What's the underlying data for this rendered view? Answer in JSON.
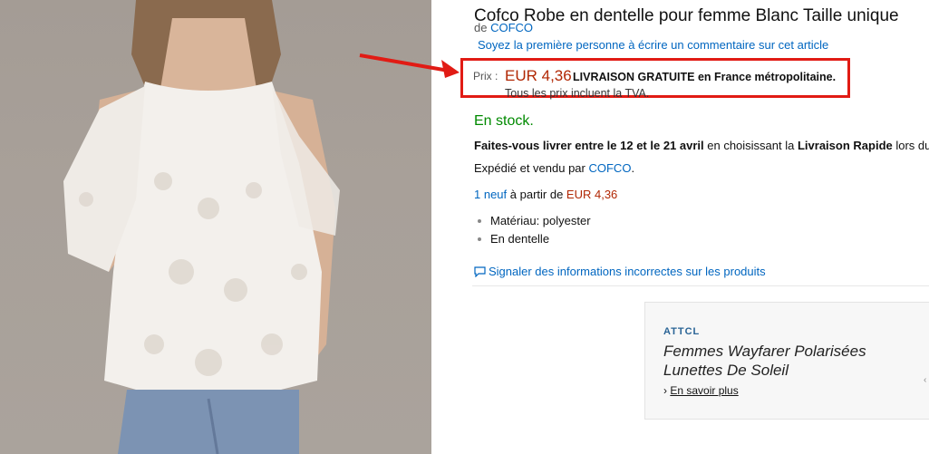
{
  "product": {
    "title": "Cofco Robe en dentelle pour femme Blanc Taille unique",
    "brand_prefix": "de",
    "brand": "COFCO",
    "review_link": "Soyez la première personne à écrire un commentaire sur cet article"
  },
  "price": {
    "label": "Prix :",
    "value": "EUR 4,36",
    "shipping": "LIVRAISON GRATUITE en France métropolitaine.",
    "vat_note": "Tous les prix incluent la TVA."
  },
  "availability": {
    "stock": "En stock.",
    "delivery_bold_1": "Faites-vous livrer entre le 12 et le 21 avril",
    "delivery_mid": " en choisissant la ",
    "delivery_bold_2": "Livraison Rapide",
    "delivery_tail": " lors du",
    "sold_by_prefix": "Expédié et vendu par ",
    "sold_by_link": "COFCO",
    "sold_by_suffix": "."
  },
  "offers": {
    "link": "1 neuf",
    "middle": " à partir de ",
    "price": "EUR 4,36"
  },
  "features": [
    "Matériau: polyester",
    "En dentelle"
  ],
  "report_link": "Signaler des informations incorrectes sur les produits",
  "ad": {
    "brand": "ATTCL",
    "headline_line1": "Femmes Wayfarer Polarisées",
    "headline_line2": "Lunettes De Soleil",
    "cta": "En savoir plus",
    "cta_icon": "chevron-right-icon"
  },
  "colors": {
    "link": "#0066c0",
    "price": "#b12704",
    "stock": "#008a00",
    "annotation": "#e11b14"
  }
}
